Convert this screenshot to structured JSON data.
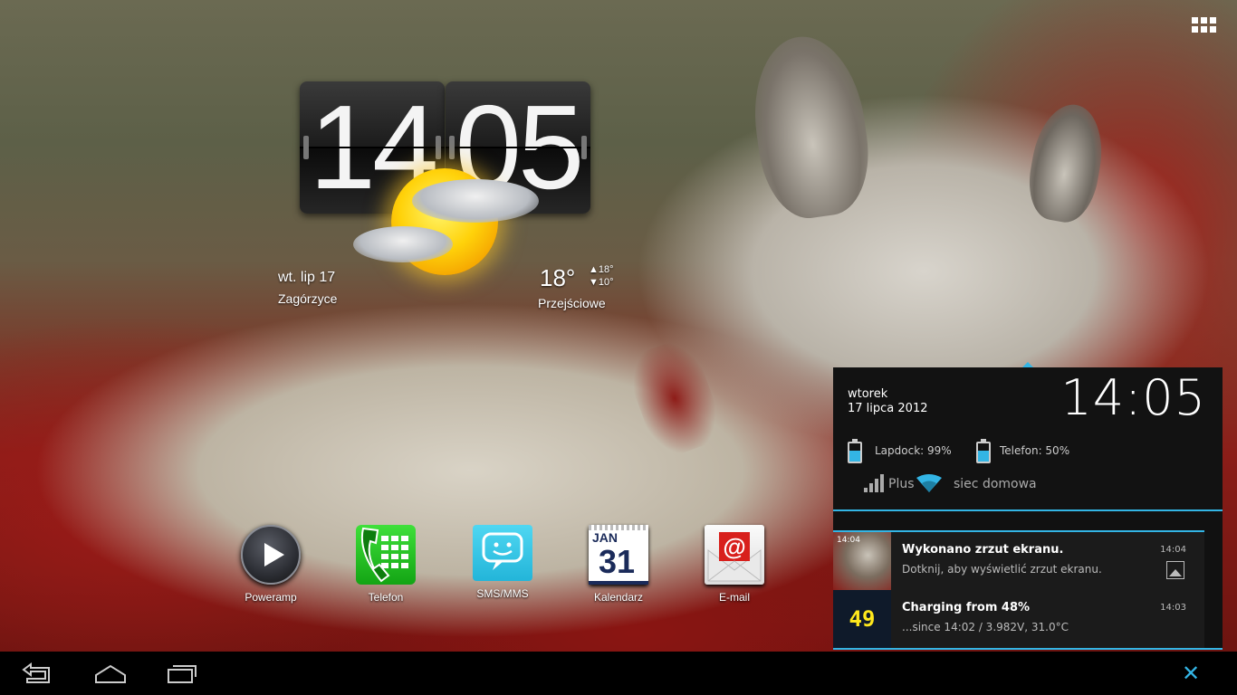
{
  "launcher": {
    "apps_button_icon": "grid-icon",
    "clock": {
      "hours": "14",
      "minutes": "05"
    },
    "weather": {
      "date": "wt. lip 17",
      "location": "Zagórzyce",
      "temperature": "18°",
      "high": "▲18°",
      "low": "▼10°",
      "condition": "Przejściowe",
      "icon": "partly-cloudy-icon"
    },
    "dock": [
      {
        "label": "Poweramp",
        "icon": "poweramp-play-icon"
      },
      {
        "label": "Telefon",
        "icon": "phone-icon"
      },
      {
        "label": "SMS/MMS",
        "icon": "sms-icon"
      },
      {
        "label": "Kalendarz",
        "icon": "calendar-icon",
        "month": "JAN",
        "day": "31"
      },
      {
        "label": "E-mail",
        "icon": "email-icon"
      }
    ]
  },
  "shade": {
    "day": "wtorek",
    "date": "17 lipca 2012",
    "time": "14:05",
    "lapdock": "Lapdock: 99%",
    "phone": "Telefon: 50%",
    "carrier": "Plus",
    "wifi": "siec domowa",
    "notifications": [
      {
        "title": "Wykonano zrzut ekranu.",
        "text": "Dotknij, aby wyświetlić zrzut ekranu.",
        "time": "14:04",
        "thumb_time": "14:04"
      },
      {
        "title": "Charging from 48%",
        "text": "...since 14:02 / 3.982V, 31.0°C",
        "time": "14:03",
        "badge": "49"
      }
    ]
  },
  "colors": {
    "accent": "#33b5e5",
    "battery_digits": "#ffe81c"
  }
}
